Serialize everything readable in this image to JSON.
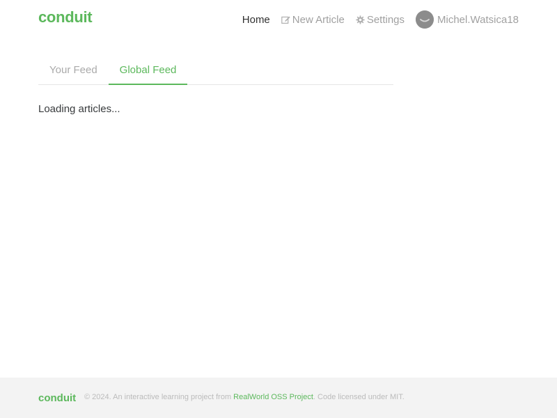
{
  "navbar": {
    "brand": "conduit",
    "links": {
      "home": "Home",
      "new_article": "New Article",
      "settings": "Settings",
      "username": "Michel.Watsica18"
    }
  },
  "feed": {
    "tabs": [
      "Your Feed",
      "Global Feed"
    ],
    "active_tab": "Global Feed",
    "loading_text": "Loading articles..."
  },
  "footer": {
    "logo": "conduit",
    "attribution_prefix": "© 2024. An interactive learning project from ",
    "link_text": "RealWorld OSS Project",
    "attribution_suffix": ". Code licensed under MIT."
  },
  "colors": {
    "brand_green": "#5cb85c",
    "footer_bg": "#f3f3f3"
  },
  "icons": [
    "edit-icon",
    "gear-icon",
    "avatar"
  ]
}
